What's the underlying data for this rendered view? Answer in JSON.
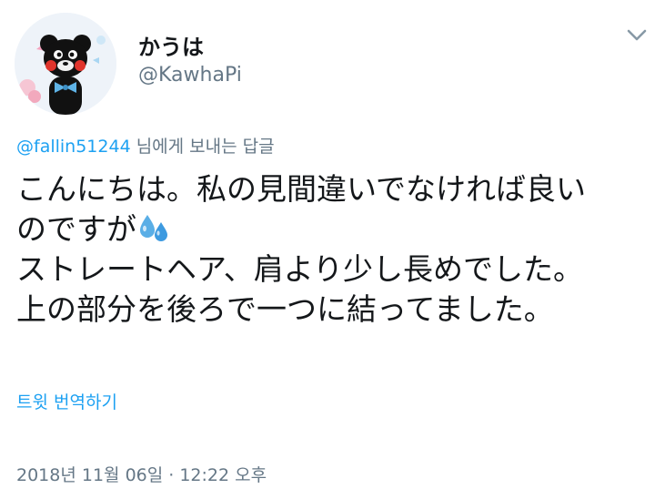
{
  "author": {
    "display_name": "かうは",
    "handle": "@KawhaPi",
    "avatar_icon": "bear-mascot-avatar"
  },
  "menu": {
    "icon": "chevron-down-icon"
  },
  "reply": {
    "to_handle": "@fallin51244",
    "suffix": " 님에게 보내는 답글"
  },
  "tweet": {
    "line1": "こんにちは。私の見間違いでなければ良い",
    "line2": "のですが",
    "emoji": "sweat-droplets-icon",
    "line3": "ストレートヘア、肩より少し長めでした。",
    "line4": "上の部分を後ろで一つに結ってました。"
  },
  "translate": {
    "label": "트윗 번역하기"
  },
  "meta": {
    "timestamp": "2018년 11월 06일 · 12:22 오후"
  },
  "colors": {
    "link": "#1da1f2",
    "muted": "#657786",
    "text": "#14171a"
  }
}
